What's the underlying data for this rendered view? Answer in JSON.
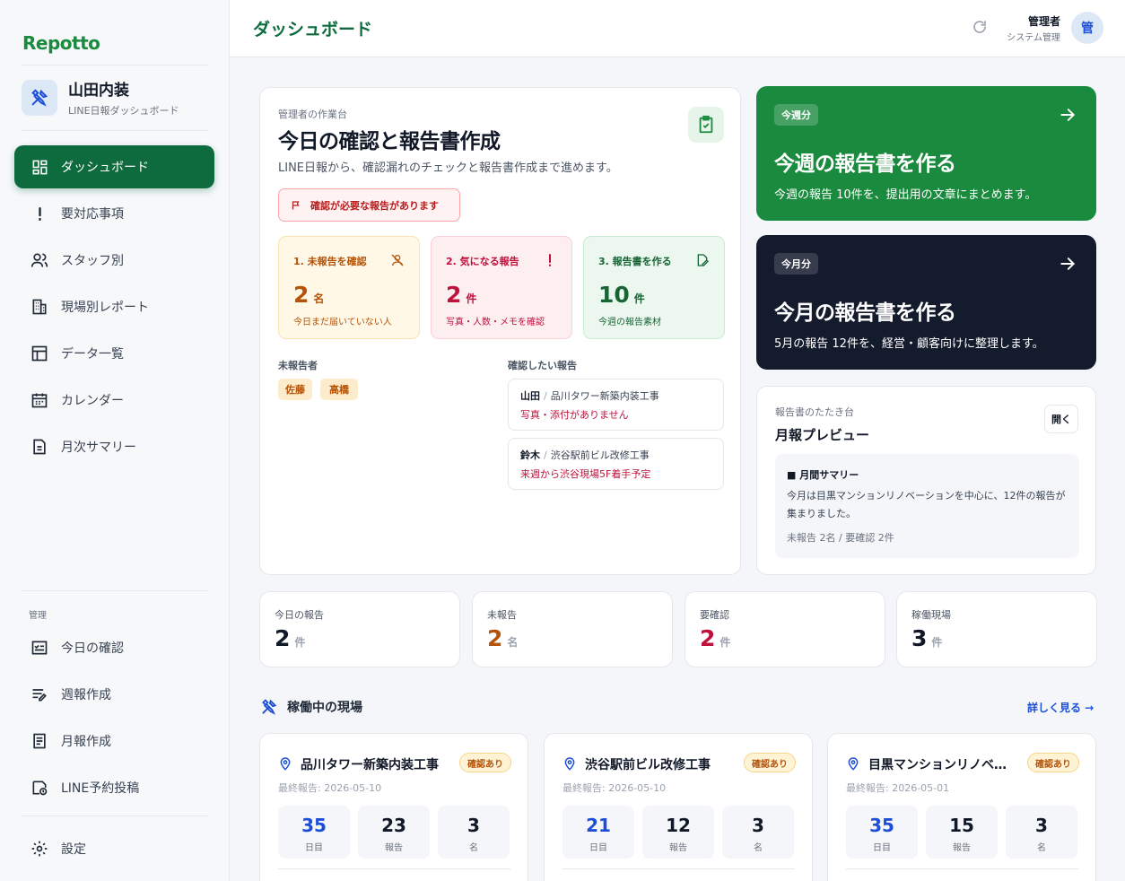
{
  "brand": {
    "logo": "Repotto",
    "company_name": "山田内装",
    "company_sub": "LINE日報ダッシュボード"
  },
  "nav": {
    "main": [
      {
        "label": "ダッシュボード",
        "icon": "dashboard-icon",
        "active": true
      },
      {
        "label": "要対応事項",
        "icon": "exclamation-icon"
      },
      {
        "label": "スタッフ別",
        "icon": "users-icon"
      },
      {
        "label": "現場別レポート",
        "icon": "building-icon"
      },
      {
        "label": "データ一覧",
        "icon": "table-icon"
      },
      {
        "label": "カレンダー",
        "icon": "calendar-icon"
      },
      {
        "label": "月次サマリー",
        "icon": "document-icon"
      }
    ],
    "section_label": "管理",
    "admin": [
      {
        "label": "今日の確認",
        "icon": "checklist-icon"
      },
      {
        "label": "週報作成",
        "icon": "edit-list-icon"
      },
      {
        "label": "月報作成",
        "icon": "report-icon"
      },
      {
        "label": "LINE予約投稿",
        "icon": "schedule-post-icon"
      }
    ],
    "settings": {
      "label": "設定",
      "icon": "gear-icon"
    }
  },
  "header": {
    "title": "ダッシュボード",
    "user_name": "管理者",
    "user_role": "システム管理",
    "avatar": "管"
  },
  "workbench": {
    "label": "管理者の作業台",
    "title": "今日の確認と報告書作成",
    "desc": "LINE日報から、確認漏れのチェックと報告書作成まで進めます。",
    "alert": "確認が必要な報告があります",
    "steps": [
      {
        "title": "1. 未報告を確認",
        "value": "2",
        "unit": "名",
        "desc": "今日まだ届いていない人"
      },
      {
        "title": "2. 気になる報告",
        "value": "2",
        "unit": "件",
        "desc": "写真・人数・メモを確認"
      },
      {
        "title": "3. 報告書を作る",
        "value": "10",
        "unit": "件",
        "desc": "今週の報告素材"
      }
    ],
    "unreported_label": "未報告者",
    "unreported": [
      "佐藤",
      "高橋"
    ],
    "check_label": "確認したい報告",
    "reports": [
      {
        "name": "山田",
        "sep": "/",
        "site": "品川タワー新築内装工事",
        "warn": "写真・添付がありません"
      },
      {
        "name": "鈴木",
        "sep": "/",
        "site": "渋谷駅前ビル改修工事",
        "warn": "来週から渋谷現場5F着手予定"
      }
    ]
  },
  "weekly": {
    "badge": "今週分",
    "title": "今週の報告書を作る",
    "desc": "今週の報告 10件を、提出用の文章にまとめます。"
  },
  "monthly": {
    "badge": "今月分",
    "title": "今月の報告書を作る",
    "desc": "5月の報告 12件を、経営・顧客向けに整理します。"
  },
  "preview": {
    "label": "報告書のたたき台",
    "title": "月報プレビュー",
    "open": "開く",
    "heading": "■ 月間サマリー",
    "text": "今月は目黒マンションリノベーションを中心に、12件の報告が集まりました。",
    "meta": "未報告 2名 / 要確認 2件"
  },
  "stats": [
    {
      "label": "今日の報告",
      "value": "2",
      "unit": "件",
      "color": "#111827"
    },
    {
      "label": "未報告",
      "value": "2",
      "unit": "名",
      "color": "#b45309"
    },
    {
      "label": "要確認",
      "value": "2",
      "unit": "件",
      "color": "#be123c"
    },
    {
      "label": "稼働現場",
      "value": "3",
      "unit": "件",
      "color": "#111827"
    }
  ],
  "sites_section": {
    "title": "稼働中の現場",
    "more": "詳しく見る →"
  },
  "sites": [
    {
      "name": "品川タワー新築内装工事",
      "badge": "確認あり",
      "last": "最終報告: 2026-05-10",
      "metrics": [
        {
          "value": "35",
          "label": "日目"
        },
        {
          "value": "23",
          "label": "報告"
        },
        {
          "value": "3",
          "label": "名"
        }
      ]
    },
    {
      "name": "渋谷駅前ビル改修工事",
      "badge": "確認あり",
      "last": "最終報告: 2026-05-10",
      "metrics": [
        {
          "value": "21",
          "label": "日目"
        },
        {
          "value": "12",
          "label": "報告"
        },
        {
          "value": "3",
          "label": "名"
        }
      ]
    },
    {
      "name": "目黒マンションリノベ…",
      "badge": "確認あり",
      "last": "最終報告: 2026-05-01",
      "metrics": [
        {
          "value": "35",
          "label": "日目"
        },
        {
          "value": "15",
          "label": "報告"
        },
        {
          "value": "3",
          "label": "名"
        }
      ]
    }
  ],
  "colors": {
    "brand_green": "#1a8a3e",
    "active_nav": "#0e6b3e",
    "dark_card": "#141b2d",
    "warn_red": "#be123c",
    "amber": "#b45309",
    "link_blue": "#1d4ed8"
  }
}
